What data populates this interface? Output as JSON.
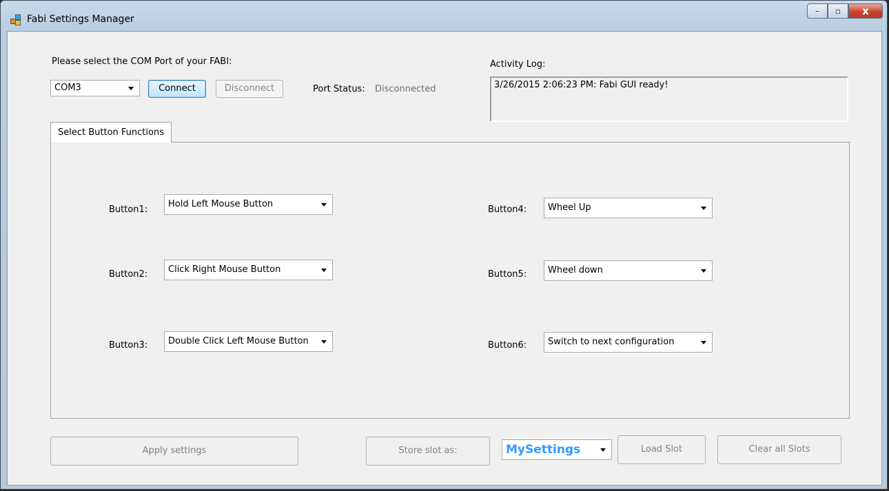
{
  "window": {
    "title": "Fabi Settings Manager",
    "controls": {
      "minimize": "–",
      "maximize": "▫",
      "close": "x"
    }
  },
  "com": {
    "prompt": "Please select the COM Port of your FABI:",
    "port_value": "COM3",
    "connect_label": "Connect",
    "disconnect_label": "Disconnect",
    "status_label": "Port Status:",
    "status_value": "Disconnected"
  },
  "log": {
    "label": "Activity Log:",
    "entries": "3/26/2015 2:06:23 PM: Fabi GUI ready!"
  },
  "tab": {
    "label": "Select Button Functions"
  },
  "buttons": [
    {
      "label": "Button1:",
      "value": "Hold Left Mouse Button"
    },
    {
      "label": "Button2:",
      "value": "Click Right Mouse Button"
    },
    {
      "label": "Button3:",
      "value": "Double Click Left Mouse Button"
    },
    {
      "label": "Button4:",
      "value": "Wheel Up"
    },
    {
      "label": "Button5:",
      "value": "Wheel down"
    },
    {
      "label": "Button6:",
      "value": "Switch to next configuration"
    }
  ],
  "footer": {
    "apply_label": "Apply settings",
    "store_label": "Store slot as:",
    "slot_value": "MySettings",
    "load_label": "Load Slot",
    "clear_label": "Clear all Slots"
  },
  "colors": {
    "accent_blue": "#3399ff",
    "status_gray": "#6d6d6d",
    "disabled_text": "#838383"
  }
}
